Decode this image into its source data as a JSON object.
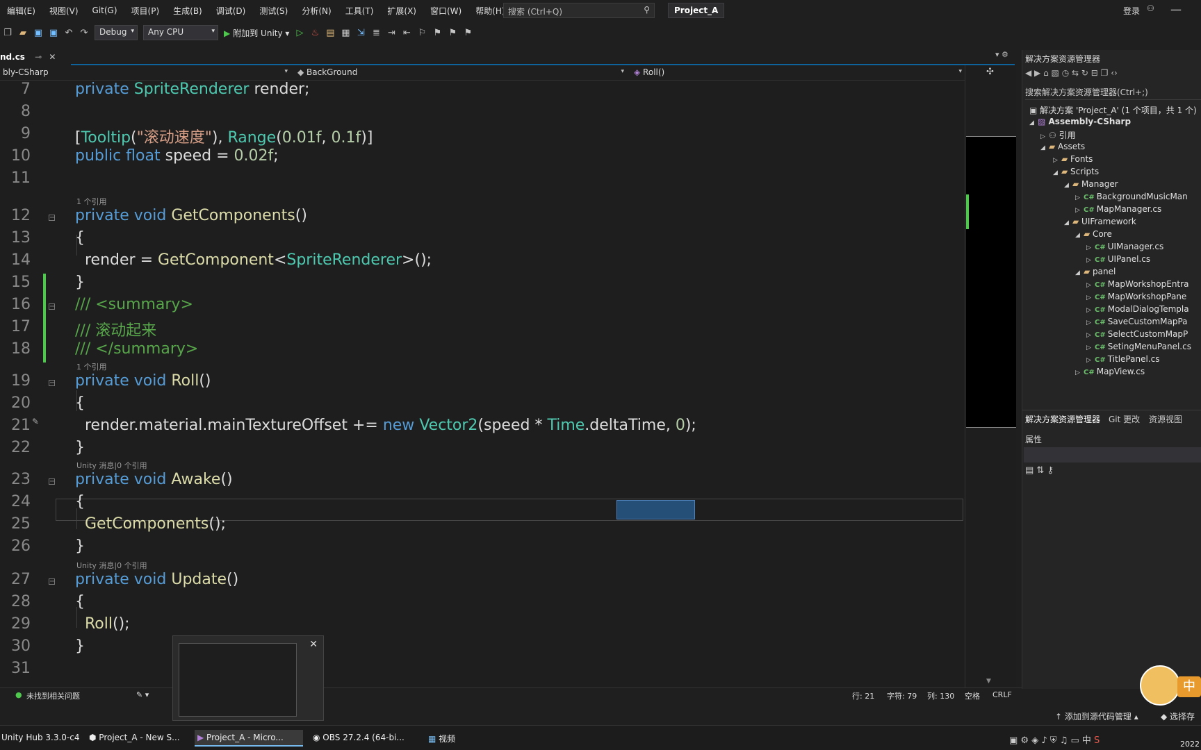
{
  "menubar": {
    "items": [
      "编辑(E)",
      "视图(V)",
      "Git(G)",
      "项目(P)",
      "生成(B)",
      "调试(D)",
      "测试(S)",
      "分析(N)",
      "工具(T)",
      "扩展(X)",
      "窗口(W)",
      "帮助(H)"
    ],
    "search_placeholder": "搜索 (Ctrl+Q)",
    "project_name": "Project_A",
    "login_label": "登录"
  },
  "toolbar": {
    "config": "Debug",
    "platform": "Any CPU",
    "run_label": "附加到 Unity"
  },
  "tabs": {
    "active_file": "nd.cs"
  },
  "navbar": {
    "project": "bly-CSharp",
    "class": "BackGround",
    "member": "Roll()"
  },
  "editor": {
    "codelens": {
      "refs_1": "1 个引用",
      "unity_0": "Unity 消息|0 个引用"
    },
    "line_numbers": [
      "7",
      "8",
      "9",
      "10",
      "11",
      "12",
      "13",
      "14",
      "15",
      "16",
      "17",
      "18",
      "19",
      "20",
      "21",
      "22",
      "23",
      "24",
      "25",
      "26",
      "27",
      "28",
      "29",
      "30",
      "31"
    ]
  },
  "solution_explorer": {
    "title": "解决方案资源管理器",
    "search_placeholder": "搜索解决方案资源管理器(Ctrl+;)",
    "solution_label": "解决方案 'Project_A' (1 个项目，共 1 个)",
    "project": "Assembly-CSharp",
    "items": {
      "refs": "引用",
      "assets": "Assets",
      "fonts": "Fonts",
      "scripts": "Scripts",
      "manager": "Manager",
      "bgmusic": "BackgroundMusicMan",
      "mapmanager": "MapManager.cs",
      "uiframework": "UIFramework",
      "core": "Core",
      "uimanager": "UIManager.cs",
      "uipanel": "UIPanel.cs",
      "panel": "panel",
      "mapworkshopentra": "MapWorkshopEntra",
      "mapworkshoppane": "MapWorkshopPane",
      "modaldialog": "ModalDialogTempla",
      "savecustom": "SaveCustomMapPa",
      "selectcustom": "SelectCustomMapP",
      "setingmenu": "SetingMenuPanel.cs",
      "titlepanel": "TitlePanel.cs",
      "mapview": "MapView.cs"
    },
    "bottom_tabs": [
      "解决方案资源管理器",
      "Git 更改",
      "资源视图"
    ],
    "properties_title": "属性"
  },
  "statusbar": {
    "issues": "未找到相关问题",
    "row": "行: 21",
    "char": "字符: 79",
    "col": "列: 130",
    "ws": "空格",
    "eol": "CRLF",
    "source_control": "添加到源代码管理",
    "repo": "选择存"
  },
  "taskbar": {
    "items": [
      "Unity Hub 3.3.0-c4",
      "Project_A - New S...",
      "Project_A - Micro...",
      "OBS 27.2.4 (64-bi...",
      "视频"
    ],
    "ime": "中",
    "year": "2022"
  },
  "mascot_badge": "中"
}
